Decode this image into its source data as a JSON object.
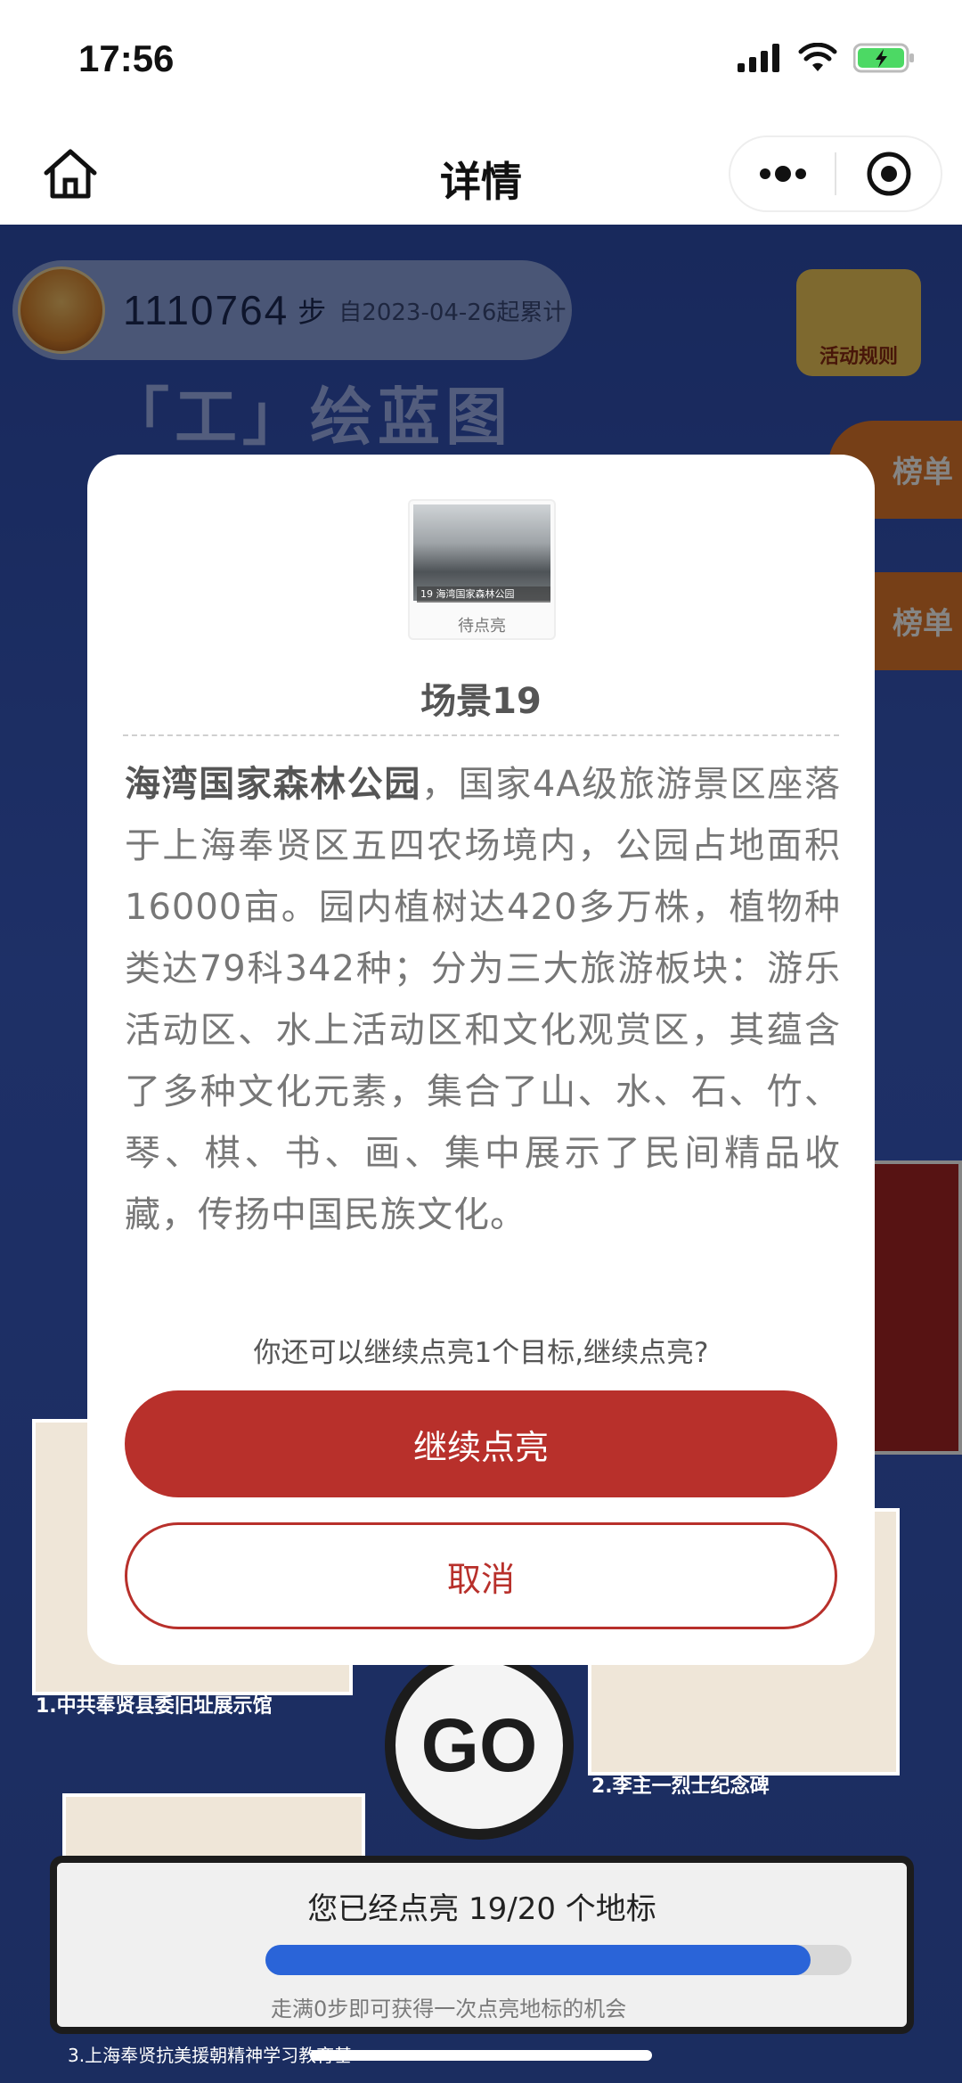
{
  "status_bar": {
    "time": "17:56"
  },
  "nav": {
    "title": "详情"
  },
  "background": {
    "steps_value": "1110764",
    "steps_unit": "步",
    "steps_since": "自2023-04-26起累计",
    "banner_text": "「工」绘蓝图",
    "rules_label": "活动规则",
    "rank_label_1": "榜单",
    "rank_label_2": "榜单",
    "card_a_label": "1.中共奉贤县委旧址展示馆",
    "card_b_label": "2.李主一烈士纪念碑",
    "go_label": "GO",
    "bottom_title": "您已经点亮 19/20 个地标",
    "progress": 0.93,
    "bottom_hint": "走满0步即可获得一次点亮地标的机会",
    "bottom_card_label": "3.上海奉贤抗美援朝精神学习教育基"
  },
  "modal": {
    "thumb_caption_num": "19",
    "thumb_caption": "海湾国家森林公园",
    "thumb_status": "待点亮",
    "scene_title": "场景19",
    "desc_bold": "海湾国家森林公园",
    "desc_rest": "，国家4A级旅游景区座落于上海奉贤区五四农场境内，公园占地面积16000亩。园内植树达420多万株，植物种类达79科342种；分为三大旅游板块：游乐活动区、水上活动区和文化观赏区，其蕴含了多种文化元素，集合了山、水、石、竹、琴、棋、书、画、集中展示了民间精品收藏，传扬中国民族文化。",
    "question": "你还可以继续点亮1个目标,继续点亮?",
    "confirm_label": "继续点亮",
    "cancel_label": "取消"
  },
  "colors": {
    "accent": "#b8302b",
    "progress": "#2a64d8"
  }
}
